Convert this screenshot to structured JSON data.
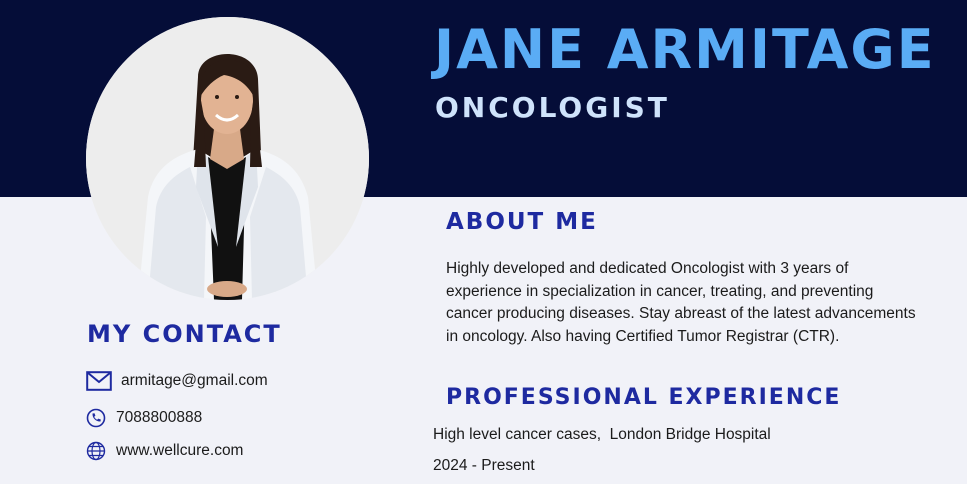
{
  "header": {
    "name": "JANE ARMITAGE",
    "title": "ONCOLOGIST"
  },
  "about": {
    "heading": "ABOUT ME",
    "text": "Highly developed and dedicated Oncologist with 3 years of experience in specialization in cancer, treating, and preventing cancer producing diseases. Stay abreast of the latest advancements in oncology. Also having Certified Tumor Registrar (CTR)."
  },
  "experience": {
    "heading": "PROFESSIONAL EXPERIENCE",
    "role": "High level cancer cases,  London Bridge Hospital",
    "dates": "2024 - Present"
  },
  "contact": {
    "heading": "MY CONTACT",
    "email": "armitage@gmail.com",
    "phone": "7088800888",
    "website": "www.wellcure.com"
  },
  "icons": {
    "email": "mail-icon",
    "phone": "phone-icon",
    "website": "globe-icon"
  },
  "colors": {
    "header_band": "#050d38",
    "name": "#5aacf5",
    "section_heading": "#1e2aa0",
    "background": "#f1f2f8"
  }
}
